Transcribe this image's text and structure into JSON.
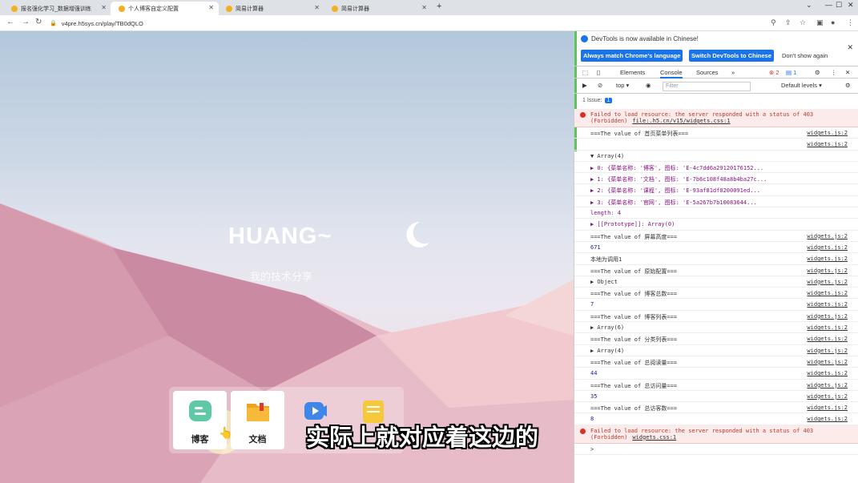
{
  "browser": {
    "tabs": [
      {
        "title": "报名强化学习_数据增强训练"
      },
      {
        "title": "个人博客自定义配置"
      },
      {
        "title": "简易计算器"
      },
      {
        "title": "简易计算器"
      }
    ],
    "url": "v4pre.h5sys.cn/play/TB0dQLO"
  },
  "page": {
    "hero_title": "HUANG~",
    "hero_subtitle": "我的技术分享",
    "dock": [
      {
        "label": "博客",
        "color": "#5fc8a4"
      },
      {
        "label": "文档",
        "color": "#f0a31c"
      },
      {
        "label": "",
        "color": "#3f86e8"
      },
      {
        "label": "",
        "color": "#f5c93a"
      }
    ],
    "caption": "实际上就对应着这边的"
  },
  "devtools": {
    "banner": "DevTools is now available in Chinese!",
    "btn_match": "Always match Chrome's language",
    "btn_switch": "Switch DevTools to Chinese",
    "btn_dont": "Don't show again",
    "tabs": [
      "Elements",
      "Console",
      "Sources",
      "»"
    ],
    "error_count": "2",
    "msg_count": "1",
    "context": "top ▾",
    "filter_placeholder": "Filter",
    "levels": "Default levels ▾",
    "issues": "1 Issue:",
    "issue_count": "1",
    "rows": [
      {
        "type": "err",
        "text": "Failed to load resource: the server responded with a status of 403 (Forbidden)",
        "src": "file:.h5.cn/v15/widgets.css:1"
      },
      {
        "type": "log",
        "text": "===The value of 首页菜单列表===",
        "src": "widgets.js:2"
      },
      {
        "type": "log",
        "text": "",
        "src": "widgets.js:2"
      },
      {
        "type": "log",
        "text": "▼ Array(4)",
        "src": ""
      },
      {
        "type": "sub",
        "text": "▶ 0: {菜单名称: '博客', 图标: 'E-4c7dd6a29120176152...",
        "src": ""
      },
      {
        "type": "sub",
        "text": "▶ 1: {菜单名称: '文档', 图标: 'E-7b6c108f48a8b4ba27c...",
        "src": ""
      },
      {
        "type": "sub",
        "text": "▶ 2: {菜单名称: '课程', 图标: 'E-93af81df0200091ed...",
        "src": ""
      },
      {
        "type": "sub",
        "text": "▶ 3: {菜单名称: '官网', 图标: 'E-5a267b7b10083644...",
        "src": ""
      },
      {
        "type": "sub",
        "text": "length: 4",
        "src": ""
      },
      {
        "type": "sub",
        "text": "▶ [[Prototype]]: Array(0)",
        "src": ""
      },
      {
        "type": "log",
        "text": "===The value of 屏幕高度===",
        "src": "widgets.js:2"
      },
      {
        "type": "num",
        "text": "671",
        "src": "widgets.js:2"
      },
      {
        "type": "log",
        "text": "本地为调用1",
        "src": "widgets.js:2"
      },
      {
        "type": "log",
        "text": "===The value of 原始配置===",
        "src": "widgets.js:2"
      },
      {
        "type": "log",
        "text": "▶ Object",
        "src": "widgets.js:2"
      },
      {
        "type": "log",
        "text": "===The value of 博客总数===",
        "src": "widgets.js:2"
      },
      {
        "type": "num",
        "text": "7",
        "src": "widgets.js:2"
      },
      {
        "type": "log",
        "text": "===The value of 博客列表===",
        "src": "widgets.js:2"
      },
      {
        "type": "log",
        "text": "▶ Array(6)",
        "src": "widgets.js:2"
      },
      {
        "type": "log",
        "text": "===The value of 分类列表===",
        "src": "widgets.js:2"
      },
      {
        "type": "log",
        "text": "▶ Array(4)",
        "src": "widgets.js:2"
      },
      {
        "type": "log",
        "text": "===The value of 总阅读量===",
        "src": "widgets.js:2"
      },
      {
        "type": "num",
        "text": "44",
        "src": "widgets.js:2"
      },
      {
        "type": "log",
        "text": "===The value of 总访问量===",
        "src": "widgets.js:2"
      },
      {
        "type": "num",
        "text": "35",
        "src": "widgets.js:2"
      },
      {
        "type": "log",
        "text": "===The value of 总访客数===",
        "src": "widgets.js:2"
      },
      {
        "type": "num",
        "text": "8",
        "src": "widgets.js:2"
      },
      {
        "type": "err",
        "text": "Failed to load resource: the server responded with a status of 403 (Forbidden)",
        "src": "widgets.css:1"
      },
      {
        "type": "log",
        "text": ">",
        "src": ""
      }
    ]
  }
}
